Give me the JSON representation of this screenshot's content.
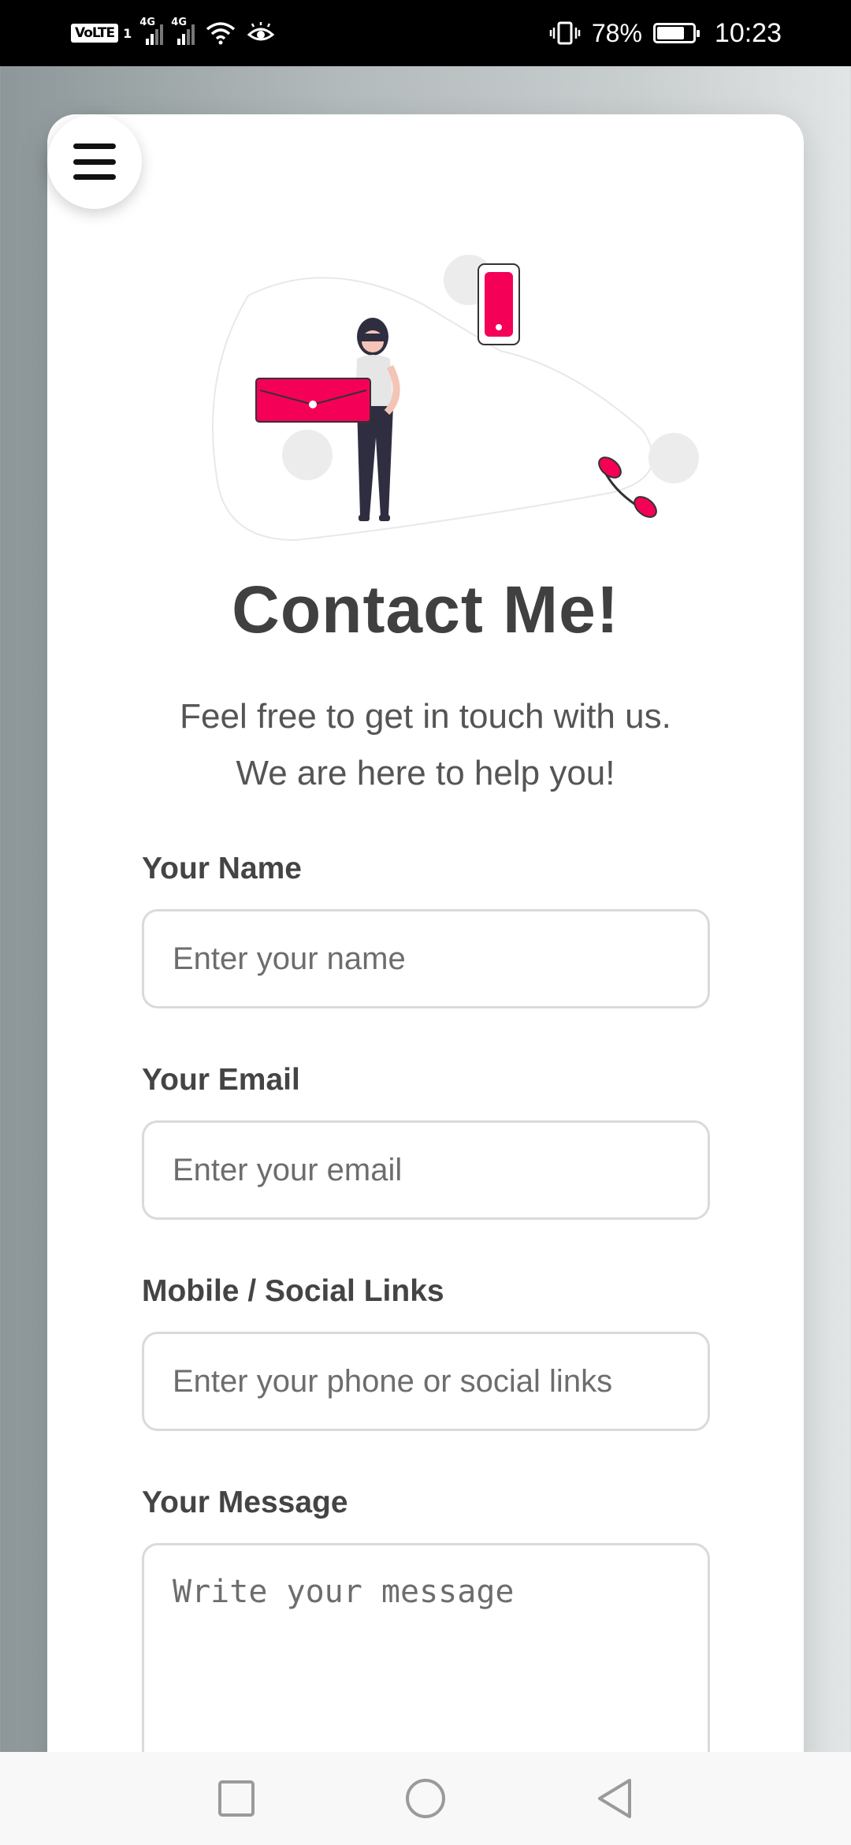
{
  "status_bar": {
    "volte": "VoLTE",
    "sim_slot": "1",
    "network_1": "4G",
    "network_2": "4G",
    "battery_percent": "78%",
    "battery_level": 0.78,
    "time": "10:23",
    "icons": [
      "volte-icon",
      "signal-icon",
      "signal-icon",
      "wifi-icon",
      "eye-icon",
      "vibrate-icon",
      "battery-icon"
    ]
  },
  "page": {
    "menu_icon": "hamburger-menu-icon",
    "illustration": "contact-illustration",
    "title": "Contact Me!",
    "subtitle_line1": "Feel free to get in touch with us.",
    "subtitle_line2": "We are here to help you!"
  },
  "form": {
    "name": {
      "label": "Your Name",
      "placeholder": "Enter your name",
      "value": ""
    },
    "email": {
      "label": "Your Email",
      "placeholder": "Enter your email",
      "value": ""
    },
    "links": {
      "label": "Mobile / Social Links",
      "placeholder": "Enter your phone or social links",
      "value": ""
    },
    "message": {
      "label": "Your Message",
      "placeholder": "Write your message",
      "value": ""
    }
  },
  "colors": {
    "accent": "#f50057",
    "title": "#404040",
    "text": "#555555"
  },
  "nav_bar": {
    "icons": [
      "recents-square-icon",
      "home-circle-icon",
      "back-triangle-icon"
    ]
  }
}
